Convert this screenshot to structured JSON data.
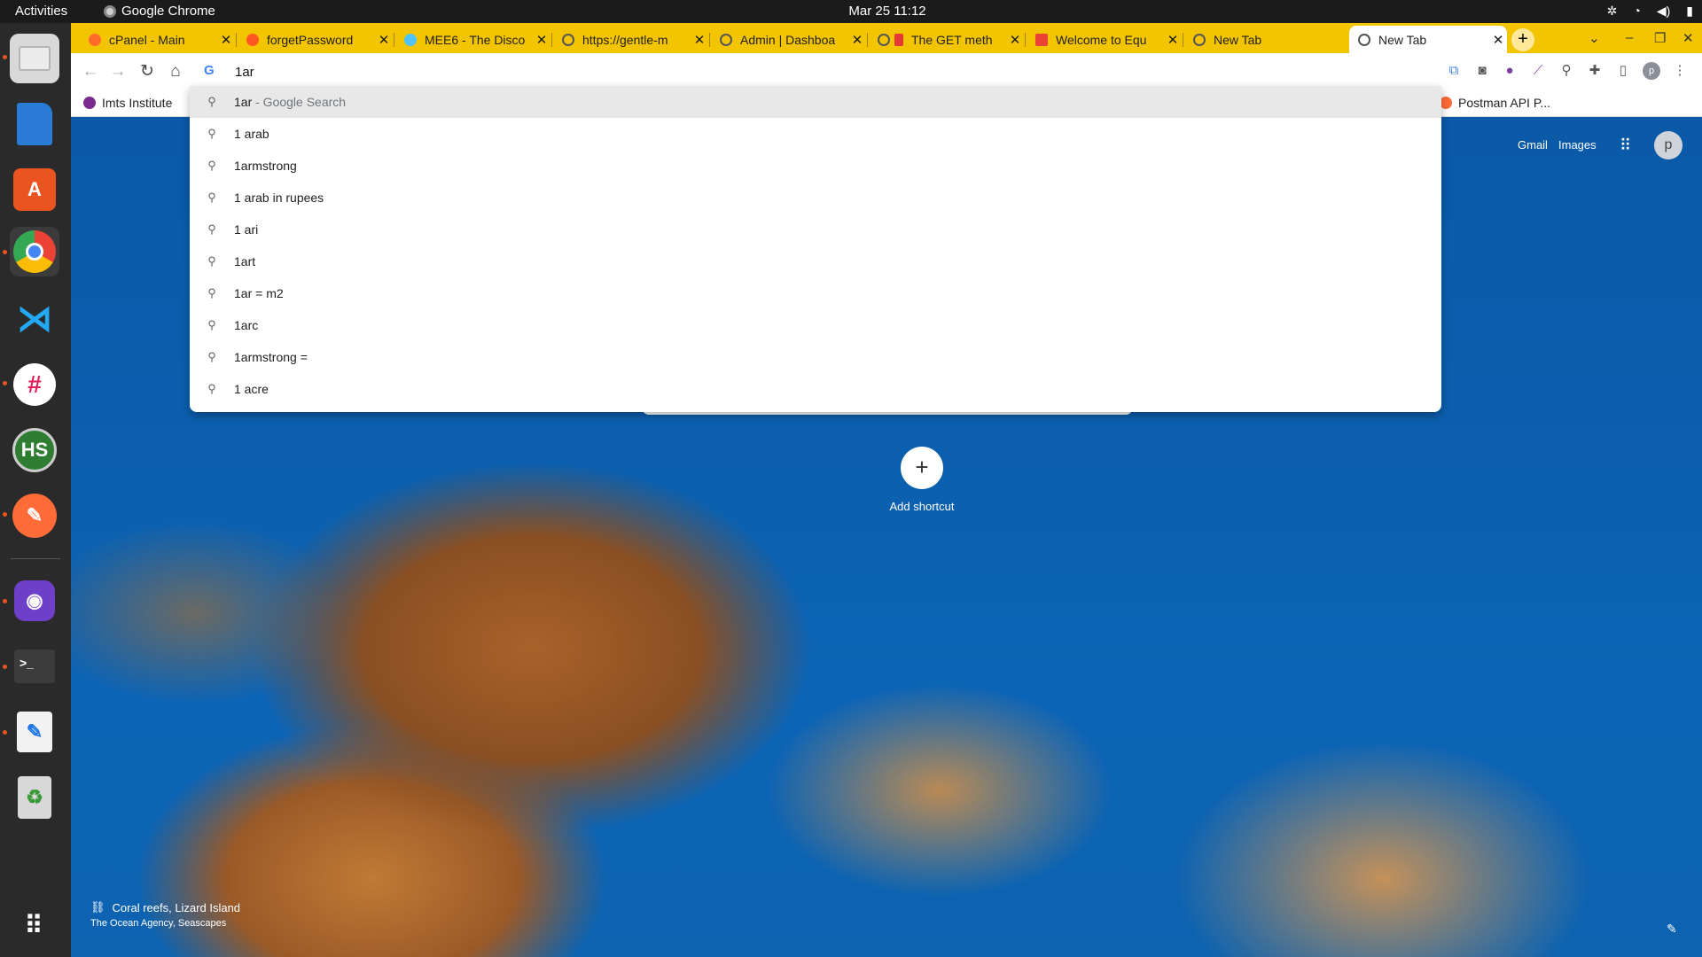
{
  "system": {
    "activities": "Activities",
    "app_name": "Google Chrome",
    "datetime": "Mar 25  11:12"
  },
  "dock": {
    "items": [
      "files",
      "libreoffice-writer",
      "app-center",
      "chrome",
      "vscode",
      "slack",
      "hs",
      "postman",
      "github-desktop",
      "terminal",
      "text-editor",
      "trash"
    ]
  },
  "tabs": [
    {
      "title": "cPanel - Main",
      "fav": "#ff6c2c"
    },
    {
      "title": "forgetPassword",
      "fav": "#ff5722"
    },
    {
      "title": "MEE6 - The Disco",
      "fav": "#4fc3f7"
    },
    {
      "title": "https://gentle-m",
      "fav": "#555555"
    },
    {
      "title": "Admin | Dashboa",
      "fav": "#555555"
    },
    {
      "title": "The GET meth",
      "fav": "#555555"
    },
    {
      "title": "Welcome to Equ",
      "fav": "#ea4335"
    },
    {
      "title": "New Tab",
      "fav": "#555555"
    },
    {
      "title": "New Tab",
      "fav": "#555555"
    }
  ],
  "omnibox": {
    "value": "1ar"
  },
  "bookmarks": [
    {
      "label": "Imts Institute"
    },
    {
      "label": "Postman API P..."
    }
  ],
  "suggestions": [
    {
      "text": "1ar",
      "sub": " - Google Search"
    },
    {
      "text": "1 arab"
    },
    {
      "text": "1armstrong"
    },
    {
      "text": "1 arab in rupees"
    },
    {
      "text": "1 ari"
    },
    {
      "text": "1art"
    },
    {
      "text": "1ar = m2"
    },
    {
      "text": "1arc"
    },
    {
      "text": "1armstrong ="
    },
    {
      "text": "1 acre"
    }
  ],
  "ntp": {
    "gmail": "Gmail",
    "images": "Images",
    "avatar": "p",
    "add_shortcut": "Add shortcut",
    "attribution_title": "Coral reefs, Lizard Island",
    "attribution_credit": "The Ocean Agency, Seascapes"
  }
}
